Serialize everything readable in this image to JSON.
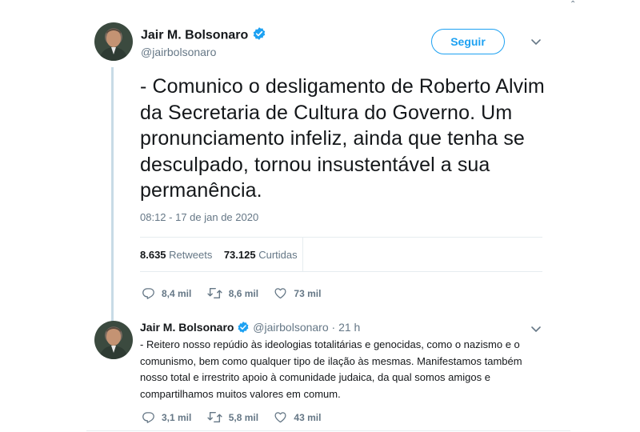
{
  "main_tweet": {
    "author_name": "Jair M. Bolsonaro",
    "author_handle": "@jairbolsonaro",
    "follow_label": "Seguir",
    "text": "- Comunico o desligamento de Roberto Alvim da Secretaria de Cultura do Governo. Um pronunciamento infeliz, ainda que tenha se desculpado, tornou insustentável a sua permanência.",
    "timestamp": "08:12 - 17 de jan de 2020",
    "retweets_count": "8.635",
    "retweets_label": "Retweets",
    "likes_count": "73.125",
    "likes_label": "Curtidas",
    "actions": {
      "replies": "8,4 mil",
      "retweets": "8,6 mil",
      "likes": "73 mil"
    }
  },
  "reply_tweet": {
    "author_name": "Jair M. Bolsonaro",
    "author_handle": "@jairbolsonaro",
    "time_ago": "21 h",
    "text": "- Reitero nosso repúdio às ideologias totalitárias e genocidas, como o nazismo e o comunismo, bem como qualquer tipo de ilação às mesmas. Manifestamos também nosso total e irrestrito apoio à comunidade judaica, da qual somos amigos e compartilhamos muitos valores em comum.",
    "actions": {
      "replies": "3,1 mil",
      "retweets": "5,8 mil",
      "likes": "43 mil"
    }
  },
  "colors": {
    "accent": "#1da1f2",
    "secondary_text": "#657786",
    "thread_line": "#c8dbe6"
  }
}
